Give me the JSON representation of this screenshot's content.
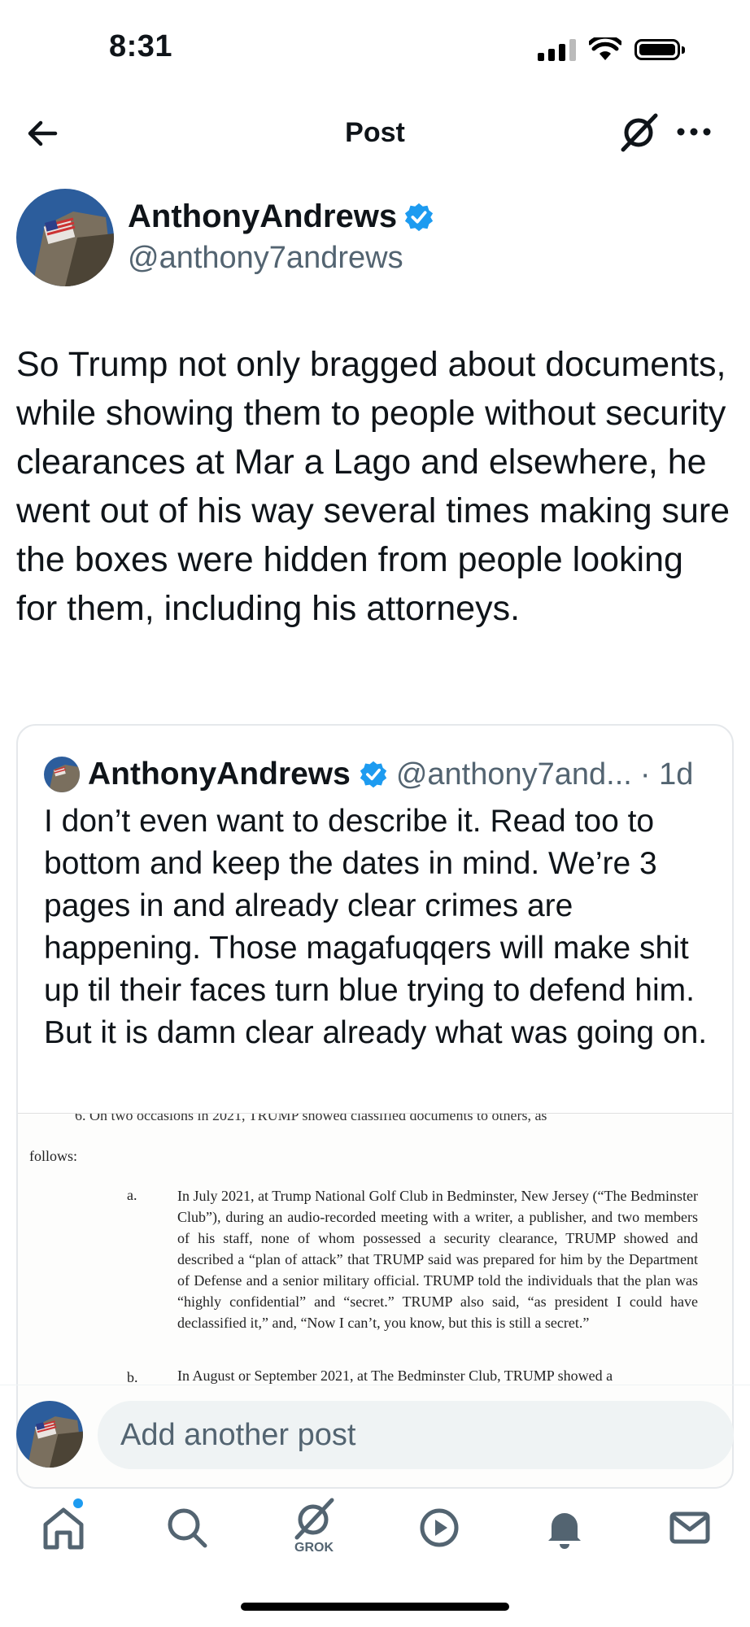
{
  "status_bar": {
    "time": "8:31"
  },
  "header": {
    "title": "Post"
  },
  "post": {
    "author_name": "AnthonyAndrews",
    "author_handle": "@anthony7andrews",
    "text": "So Trump not only bragged about documents, while showing them to people without security clearances at Mar a Lago and elsewhere, he went out of his way several times making sure the boxes were hidden from people looking for them, including his attorneys."
  },
  "quote": {
    "author_name": "AnthonyAndrews",
    "author_handle": "@anthony7and...",
    "time": "· 1d",
    "text": "I don’t even want to describe it. Read too to bottom and keep the dates in mind. We’re 3 pages in and already clear crimes are happening. Those magafuqqers will make shit up til their faces turn blue trying to defend him. But it is damn clear already what was going on.",
    "document": {
      "top_line": "6.        On two occasions in 2021, TRUMP showed classified documents to others, as",
      "follows": "follows:",
      "a_label": "a.",
      "a_text": "In July 2021, at Trump National Golf Club in Bedminster, New Jersey (“The Bedminster Club”), during an audio-recorded meeting with a writer, a publisher, and two members of his staff, none of whom possessed a security clearance, TRUMP showed and described a “plan of attack” that TRUMP said was prepared for him by the Department of Defense and a senior military official. TRUMP told the individuals that the plan was “highly confidential” and “secret.” TRUMP also said, “as president I could have declassified it,” and, “Now I can’t, you know, but this is still a secret.”",
      "b_label": "b.",
      "b_text": "In August or September 2021, at The Bedminster Club, TRUMP showed a"
    }
  },
  "reply": {
    "placeholder": "Add another post"
  },
  "tabbar": {
    "grok_label": "GROK"
  },
  "colors": {
    "accent": "#1d9bf0",
    "secondary_text": "#536471",
    "input_bg": "#eff3f4"
  }
}
